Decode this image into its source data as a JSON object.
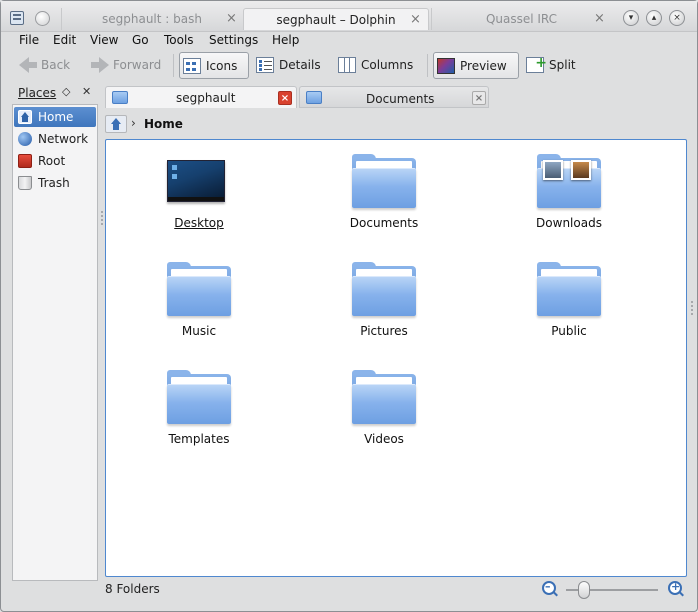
{
  "window_tabs": [
    {
      "title": "segphault : bash",
      "active": false
    },
    {
      "title": "segphault – Dolphin",
      "active": true
    },
    {
      "title": "Quassel IRC",
      "active": false
    }
  ],
  "menu": [
    "File",
    "Edit",
    "View",
    "Go",
    "Tools",
    "Settings",
    "Help"
  ],
  "toolbar": {
    "back": "Back",
    "forward": "Forward",
    "icons": "Icons",
    "details": "Details",
    "columns": "Columns",
    "preview": "Preview",
    "split": "Split"
  },
  "places": {
    "title": "Places",
    "items": [
      {
        "label": "Home",
        "icon": "home-icon",
        "active": true
      },
      {
        "label": "Network",
        "icon": "globe-icon",
        "active": false
      },
      {
        "label": "Root",
        "icon": "root-folder-icon",
        "active": false
      },
      {
        "label": "Trash",
        "icon": "trash-icon",
        "active": false
      }
    ]
  },
  "view_tabs": [
    {
      "label": "segphault",
      "active": true
    },
    {
      "label": "Documents",
      "active": false
    }
  ],
  "breadcrumb": {
    "current": "Home"
  },
  "items": [
    {
      "label": "Desktop",
      "icon": "desktop-folder-icon"
    },
    {
      "label": "Documents",
      "icon": "folder-icon"
    },
    {
      "label": "Downloads",
      "icon": "downloads-folder-icon"
    },
    {
      "label": "Music",
      "icon": "folder-icon"
    },
    {
      "label": "Pictures",
      "icon": "folder-icon"
    },
    {
      "label": "Public",
      "icon": "folder-icon"
    },
    {
      "label": "Templates",
      "icon": "folder-icon"
    },
    {
      "label": "Videos",
      "icon": "folder-icon"
    }
  ],
  "status": {
    "text": "8 Folders"
  },
  "zoom": {
    "level": 0.2
  },
  "colors": {
    "accent": "#4f88cf",
    "selection": "#3f76bd",
    "close_red": "#d9422f"
  }
}
